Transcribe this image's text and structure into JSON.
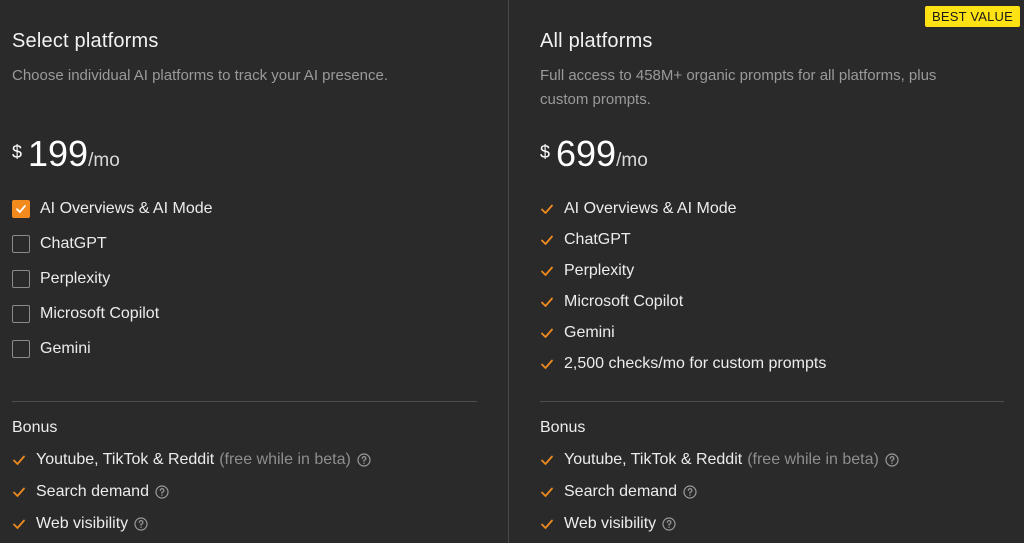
{
  "colors": {
    "accent": "#f28a1e",
    "badge": "#ffe213",
    "background": "#2a2a2a"
  },
  "left": {
    "title": "Select platforms",
    "subtitle": "Choose individual AI platforms to track your AI presence.",
    "price": {
      "currency": "$",
      "amount": "199",
      "period": "/mo"
    },
    "platforms": [
      {
        "label": "AI Overviews & AI Mode",
        "checked": true
      },
      {
        "label": "ChatGPT",
        "checked": false
      },
      {
        "label": "Perplexity",
        "checked": false
      },
      {
        "label": "Microsoft Copilot",
        "checked": false
      },
      {
        "label": "Gemini",
        "checked": false
      }
    ],
    "bonus_label": "Bonus",
    "bonus": [
      {
        "label": "Youtube, TikTok & Reddit",
        "note": "(free while in beta)"
      },
      {
        "label": "Search demand"
      },
      {
        "label": "Web visibility"
      }
    ]
  },
  "right": {
    "badge": "BEST VALUE",
    "title": "All platforms",
    "subtitle_line1": "Full access to 458M+ organic prompts for all platforms, plus",
    "subtitle_line2": "custom prompts.",
    "price": {
      "currency": "$",
      "amount": "699",
      "period": "/mo"
    },
    "features": [
      "AI Overviews & AI Mode",
      "ChatGPT",
      "Perplexity",
      "Microsoft Copilot",
      "Gemini",
      "2,500 checks/mo for custom prompts"
    ],
    "bonus_label": "Bonus",
    "bonus": [
      {
        "label": "Youtube, TikTok & Reddit",
        "note": "(free while in beta)"
      },
      {
        "label": "Search demand"
      },
      {
        "label": "Web visibility"
      }
    ]
  },
  "icons": {
    "check": "check-icon",
    "help": "help-circle-icon"
  }
}
